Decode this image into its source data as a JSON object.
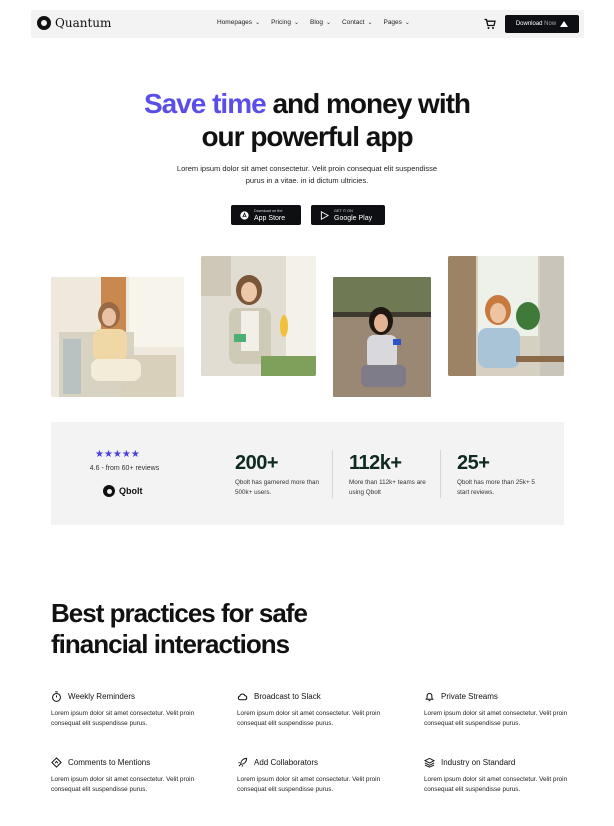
{
  "nav": {
    "logo": "Quantum",
    "menu": [
      {
        "label": "Homepages"
      },
      {
        "label": "Pricing"
      },
      {
        "label": "Blog"
      },
      {
        "label": "Contact"
      },
      {
        "label": "Pages"
      }
    ],
    "download_label": "Download",
    "download_label_2": "Now",
    "icons": [
      "cart-icon",
      "download-icon"
    ]
  },
  "hero": {
    "title_accent": "Save time",
    "title_rest_1": " and money with",
    "title_line2": "our powerful app",
    "subtitle": "Lorem ipsum dolor sit amet consectetur. Velit proin consequat elit suspendisse purus in a vitae. in id dictum ultricies.",
    "app_store": {
      "small": "Download on the",
      "big": "App Store"
    },
    "google_play": {
      "small": "GET IT ON",
      "big": "Google Play"
    }
  },
  "stats": {
    "stars": "★★★★★",
    "review": "4.6 - from 60+ reviews",
    "brand": "Qbolt",
    "items": [
      {
        "value": "200+",
        "desc": "Qbolt has garnered more than 500k+ users."
      },
      {
        "value": "112k+",
        "desc": "More than 112k+ teams are using Qbolt"
      },
      {
        "value": "25+",
        "desc": "Qbolt has more than 25k+ 5 start reviews."
      }
    ]
  },
  "features": {
    "title_line1": "Best practices for safe",
    "title_line2": "financial interactions",
    "items": [
      {
        "title": "Weekly Reminders",
        "icon": "stopwatch-icon",
        "desc": "Lorem ipsum dolor sit amet consectetur. Velit proin consequat elit suspendisse purus."
      },
      {
        "title": "Broadcast to Slack",
        "icon": "cloud-icon",
        "desc": "Lorem ipsum dolor sit amet consectetur. Velit proin consequat elit suspendisse purus."
      },
      {
        "title": "Private Streams",
        "icon": "bell-icon",
        "desc": "Lorem ipsum dolor sit amet consectetur. Velit proin consequat elit suspendisse purus."
      },
      {
        "title": "Comments to Mentions",
        "icon": "diamond-icon",
        "desc": "Lorem ipsum dolor sit amet consectetur. Velit proin consequat elit suspendisse purus."
      },
      {
        "title": "Add Collaborators",
        "icon": "rocket-icon",
        "desc": "Lorem ipsum dolor sit amet consectetur. Velit proin consequat elit suspendisse purus."
      },
      {
        "title": "Industry on Standard",
        "icon": "layers-icon",
        "desc": "Lorem ipsum dolor sit amet consectetur. Velit proin consequat elit suspendisse purus."
      }
    ]
  },
  "colors": {
    "accent": "#5b4ee8",
    "dark": "#0e0f12",
    "panel": "#f3f3f3",
    "stat_number": "#0f2a22",
    "star": "#4b3fdc"
  }
}
